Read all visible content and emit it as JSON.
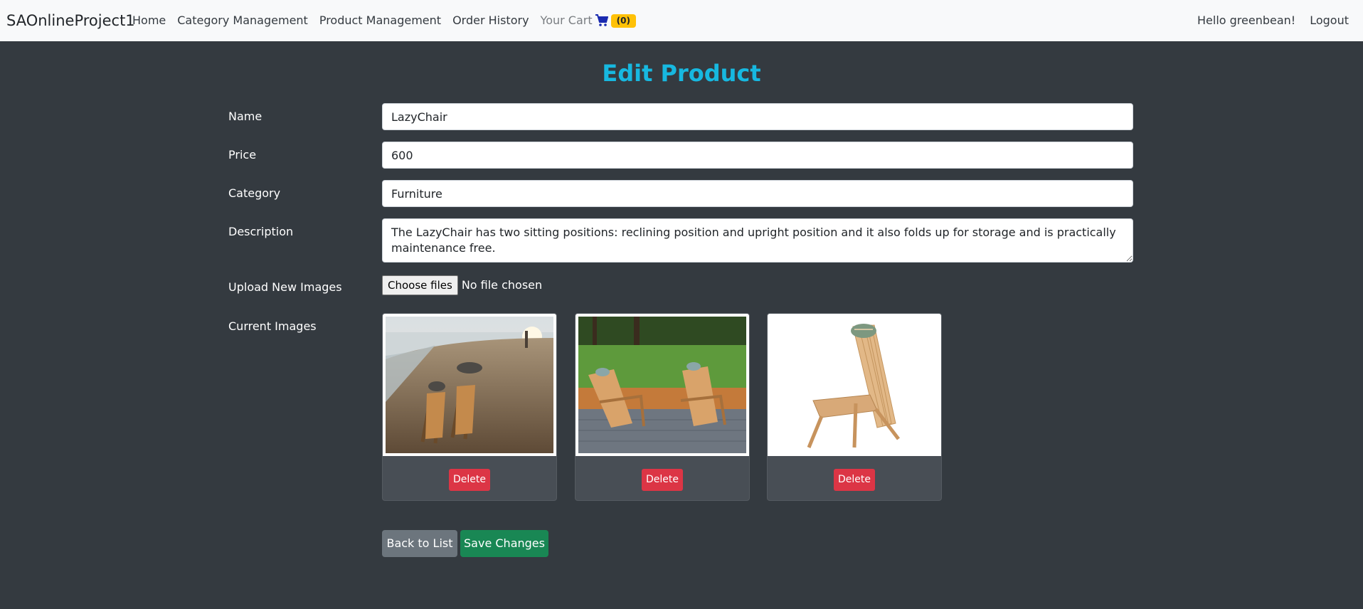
{
  "navbar": {
    "brand": "SAOnlineProject1",
    "links": [
      "Home",
      "Category Management",
      "Product Management",
      "Order History"
    ],
    "cart_label": "Your Cart",
    "cart_count": "(0)",
    "greeting": "Hello greenbean!",
    "logout": "Logout"
  },
  "page": {
    "title": "Edit Product"
  },
  "form": {
    "name_label": "Name",
    "name_value": "LazyChair",
    "price_label": "Price",
    "price_value": "600",
    "category_label": "Category",
    "category_value": "Furniture",
    "description_label": "Description",
    "description_value": "The LazyChair has two sitting positions: reclining position and upright position and it also folds up for storage and is practically maintenance free.",
    "upload_label": "Upload New Images",
    "choose_files": "Choose files",
    "no_file": "No file chosen",
    "current_images_label": "Current Images"
  },
  "images": [
    {
      "alt": "beach-chairs-photo",
      "delete_label": "Delete"
    },
    {
      "alt": "patio-chairs-photo",
      "delete_label": "Delete"
    },
    {
      "alt": "wooden-lounge-chair-photo",
      "delete_label": "Delete"
    }
  ],
  "actions": {
    "back": "Back to List",
    "save": "Save Changes"
  },
  "colors": {
    "title": "#17b8e0",
    "background": "#343a40",
    "badge": "#ffc107",
    "danger": "#dc3545",
    "success": "#198754",
    "secondary": "#6c757d"
  }
}
